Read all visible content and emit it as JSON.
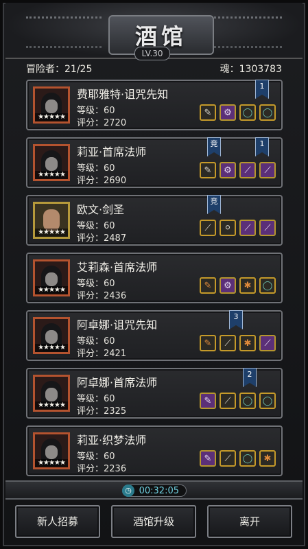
{
  "header": {
    "title": "酒馆",
    "level": "LV.30"
  },
  "stats": {
    "adventurers": "冒险者：21/25",
    "souls": "魂：1303783"
  },
  "heroes": [
    {
      "name": "费耶雅特·诅咒先知",
      "level": "等级：60",
      "score": "评分：2720",
      "stars": "★★★★★",
      "banner": "1",
      "items": [
        "✎",
        "⚙",
        "◯",
        "◯"
      ]
    },
    {
      "name": "莉亚·首席法师",
      "level": "等级：60",
      "score": "评分：2690",
      "stars": "★★★★★",
      "banner1": "竞",
      "banner2": "1",
      "items": [
        "✎",
        "⚙",
        "⟋",
        "⟋"
      ]
    },
    {
      "name": "欧文·剑圣",
      "level": "等级：60",
      "score": "评分：2487",
      "stars": "★★★★★",
      "banner": "竞",
      "items": [
        "⟋",
        "⚪",
        "⟋",
        "⟋"
      ]
    },
    {
      "name": "艾莉森·首席法师",
      "level": "等级：60",
      "score": "评分：2436",
      "stars": "★★★★★",
      "items": [
        "✎",
        "⚙",
        "✱",
        "◯"
      ]
    },
    {
      "name": "阿卓娜·诅咒先知",
      "level": "等级：60",
      "score": "评分：2421",
      "stars": "★★★★★",
      "banner": "3",
      "items": [
        "✎",
        "⟋",
        "✱",
        "⟋"
      ]
    },
    {
      "name": "阿卓娜·首席法师",
      "level": "等级：60",
      "score": "评分：2325",
      "stars": "★★★★★",
      "banner": "2",
      "items": [
        "✎",
        "⟋",
        "◯",
        "◯"
      ]
    },
    {
      "name": "莉亚·织梦法师",
      "level": "等级：60",
      "score": "评分：2236",
      "stars": "★★★★★",
      "items": [
        "✎",
        "⟋",
        "◯",
        "✱"
      ]
    }
  ],
  "timer": "00:32:05",
  "buttons": {
    "recruit": "新人招募",
    "upgrade": "酒馆升级",
    "leave": "离开"
  }
}
